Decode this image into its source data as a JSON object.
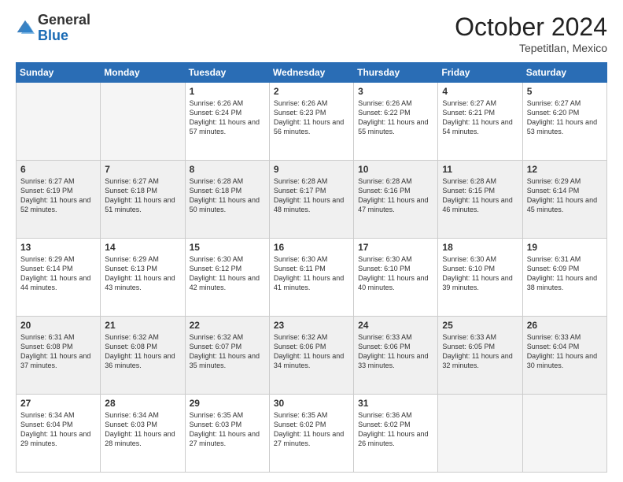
{
  "header": {
    "logo_general": "General",
    "logo_blue": "Blue",
    "month_year": "October 2024",
    "location": "Tepetitlan, Mexico"
  },
  "weekdays": [
    "Sunday",
    "Monday",
    "Tuesday",
    "Wednesday",
    "Thursday",
    "Friday",
    "Saturday"
  ],
  "weeks": [
    [
      {
        "day": "",
        "empty": true
      },
      {
        "day": "",
        "empty": true
      },
      {
        "day": "1",
        "sunrise": "Sunrise: 6:26 AM",
        "sunset": "Sunset: 6:24 PM",
        "daylight": "Daylight: 11 hours and 57 minutes."
      },
      {
        "day": "2",
        "sunrise": "Sunrise: 6:26 AM",
        "sunset": "Sunset: 6:23 PM",
        "daylight": "Daylight: 11 hours and 56 minutes."
      },
      {
        "day": "3",
        "sunrise": "Sunrise: 6:26 AM",
        "sunset": "Sunset: 6:22 PM",
        "daylight": "Daylight: 11 hours and 55 minutes."
      },
      {
        "day": "4",
        "sunrise": "Sunrise: 6:27 AM",
        "sunset": "Sunset: 6:21 PM",
        "daylight": "Daylight: 11 hours and 54 minutes."
      },
      {
        "day": "5",
        "sunrise": "Sunrise: 6:27 AM",
        "sunset": "Sunset: 6:20 PM",
        "daylight": "Daylight: 11 hours and 53 minutes."
      }
    ],
    [
      {
        "day": "6",
        "sunrise": "Sunrise: 6:27 AM",
        "sunset": "Sunset: 6:19 PM",
        "daylight": "Daylight: 11 hours and 52 minutes."
      },
      {
        "day": "7",
        "sunrise": "Sunrise: 6:27 AM",
        "sunset": "Sunset: 6:18 PM",
        "daylight": "Daylight: 11 hours and 51 minutes."
      },
      {
        "day": "8",
        "sunrise": "Sunrise: 6:28 AM",
        "sunset": "Sunset: 6:18 PM",
        "daylight": "Daylight: 11 hours and 50 minutes."
      },
      {
        "day": "9",
        "sunrise": "Sunrise: 6:28 AM",
        "sunset": "Sunset: 6:17 PM",
        "daylight": "Daylight: 11 hours and 48 minutes."
      },
      {
        "day": "10",
        "sunrise": "Sunrise: 6:28 AM",
        "sunset": "Sunset: 6:16 PM",
        "daylight": "Daylight: 11 hours and 47 minutes."
      },
      {
        "day": "11",
        "sunrise": "Sunrise: 6:28 AM",
        "sunset": "Sunset: 6:15 PM",
        "daylight": "Daylight: 11 hours and 46 minutes."
      },
      {
        "day": "12",
        "sunrise": "Sunrise: 6:29 AM",
        "sunset": "Sunset: 6:14 PM",
        "daylight": "Daylight: 11 hours and 45 minutes."
      }
    ],
    [
      {
        "day": "13",
        "sunrise": "Sunrise: 6:29 AM",
        "sunset": "Sunset: 6:14 PM",
        "daylight": "Daylight: 11 hours and 44 minutes."
      },
      {
        "day": "14",
        "sunrise": "Sunrise: 6:29 AM",
        "sunset": "Sunset: 6:13 PM",
        "daylight": "Daylight: 11 hours and 43 minutes."
      },
      {
        "day": "15",
        "sunrise": "Sunrise: 6:30 AM",
        "sunset": "Sunset: 6:12 PM",
        "daylight": "Daylight: 11 hours and 42 minutes."
      },
      {
        "day": "16",
        "sunrise": "Sunrise: 6:30 AM",
        "sunset": "Sunset: 6:11 PM",
        "daylight": "Daylight: 11 hours and 41 minutes."
      },
      {
        "day": "17",
        "sunrise": "Sunrise: 6:30 AM",
        "sunset": "Sunset: 6:10 PM",
        "daylight": "Daylight: 11 hours and 40 minutes."
      },
      {
        "day": "18",
        "sunrise": "Sunrise: 6:30 AM",
        "sunset": "Sunset: 6:10 PM",
        "daylight": "Daylight: 11 hours and 39 minutes."
      },
      {
        "day": "19",
        "sunrise": "Sunrise: 6:31 AM",
        "sunset": "Sunset: 6:09 PM",
        "daylight": "Daylight: 11 hours and 38 minutes."
      }
    ],
    [
      {
        "day": "20",
        "sunrise": "Sunrise: 6:31 AM",
        "sunset": "Sunset: 6:08 PM",
        "daylight": "Daylight: 11 hours and 37 minutes."
      },
      {
        "day": "21",
        "sunrise": "Sunrise: 6:32 AM",
        "sunset": "Sunset: 6:08 PM",
        "daylight": "Daylight: 11 hours and 36 minutes."
      },
      {
        "day": "22",
        "sunrise": "Sunrise: 6:32 AM",
        "sunset": "Sunset: 6:07 PM",
        "daylight": "Daylight: 11 hours and 35 minutes."
      },
      {
        "day": "23",
        "sunrise": "Sunrise: 6:32 AM",
        "sunset": "Sunset: 6:06 PM",
        "daylight": "Daylight: 11 hours and 34 minutes."
      },
      {
        "day": "24",
        "sunrise": "Sunrise: 6:33 AM",
        "sunset": "Sunset: 6:06 PM",
        "daylight": "Daylight: 11 hours and 33 minutes."
      },
      {
        "day": "25",
        "sunrise": "Sunrise: 6:33 AM",
        "sunset": "Sunset: 6:05 PM",
        "daylight": "Daylight: 11 hours and 32 minutes."
      },
      {
        "day": "26",
        "sunrise": "Sunrise: 6:33 AM",
        "sunset": "Sunset: 6:04 PM",
        "daylight": "Daylight: 11 hours and 30 minutes."
      }
    ],
    [
      {
        "day": "27",
        "sunrise": "Sunrise: 6:34 AM",
        "sunset": "Sunset: 6:04 PM",
        "daylight": "Daylight: 11 hours and 29 minutes."
      },
      {
        "day": "28",
        "sunrise": "Sunrise: 6:34 AM",
        "sunset": "Sunset: 6:03 PM",
        "daylight": "Daylight: 11 hours and 28 minutes."
      },
      {
        "day": "29",
        "sunrise": "Sunrise: 6:35 AM",
        "sunset": "Sunset: 6:03 PM",
        "daylight": "Daylight: 11 hours and 27 minutes."
      },
      {
        "day": "30",
        "sunrise": "Sunrise: 6:35 AM",
        "sunset": "Sunset: 6:02 PM",
        "daylight": "Daylight: 11 hours and 27 minutes."
      },
      {
        "day": "31",
        "sunrise": "Sunrise: 6:36 AM",
        "sunset": "Sunset: 6:02 PM",
        "daylight": "Daylight: 11 hours and 26 minutes."
      },
      {
        "day": "",
        "empty": true
      },
      {
        "day": "",
        "empty": true
      }
    ]
  ]
}
